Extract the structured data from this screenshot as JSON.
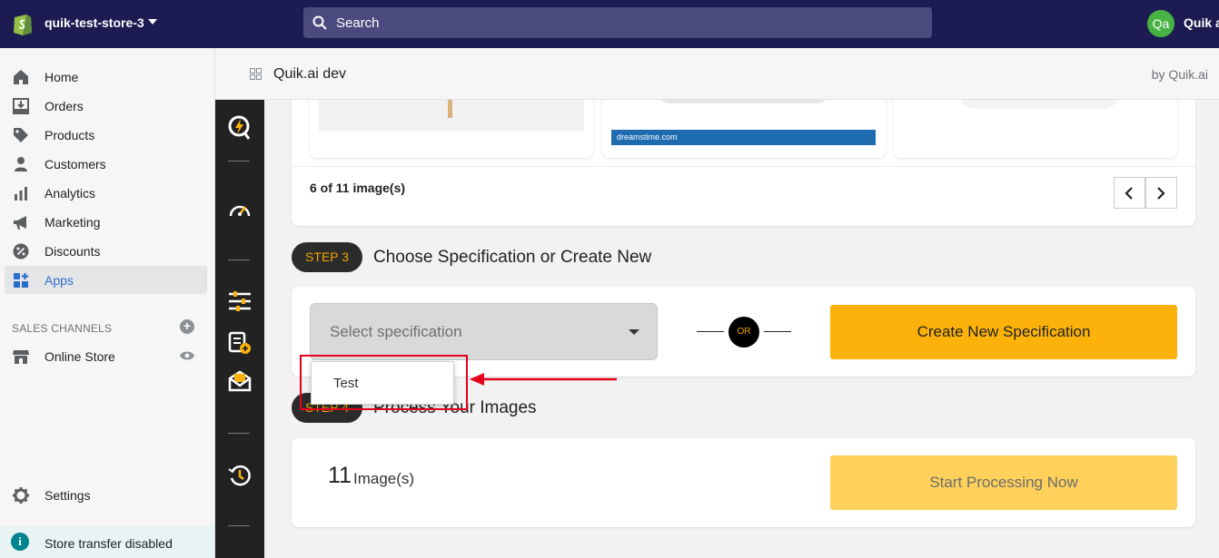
{
  "topbar": {
    "store_name": "quik-test-store-3",
    "search_placeholder": "Search",
    "avatar_initials": "Qa",
    "user_name": "Quik ai"
  },
  "sidebar": {
    "items": [
      {
        "label": "Home",
        "icon": "home-icon"
      },
      {
        "label": "Orders",
        "icon": "orders-icon"
      },
      {
        "label": "Products",
        "icon": "tag-icon"
      },
      {
        "label": "Customers",
        "icon": "person-icon"
      },
      {
        "label": "Analytics",
        "icon": "bar-chart-icon"
      },
      {
        "label": "Marketing",
        "icon": "megaphone-icon"
      },
      {
        "label": "Discounts",
        "icon": "discount-icon"
      },
      {
        "label": "Apps",
        "icon": "apps-icon",
        "active": true
      }
    ],
    "channels_header": "SALES CHANNELS",
    "online_store": "Online Store",
    "settings": "Settings",
    "transfer_notice": "Store transfer disabled"
  },
  "app_header": {
    "title": "Quik.ai dev",
    "by": "by Quik.ai"
  },
  "gallery": {
    "count_text": "6 of 11 image(s)",
    "watermark": "dreamstime.com"
  },
  "step3": {
    "pill": "STEP 3",
    "title": "Choose Specification or Create New",
    "select_placeholder": "Select specification",
    "or_label": "OR",
    "create_button": "Create New Specification"
  },
  "step4": {
    "pill": "STEP 4",
    "title": "Process Your Images",
    "count": "11",
    "count_label": "Image(s)",
    "start_button": "Start Processing Now"
  },
  "dropdown": {
    "options": [
      "Test"
    ]
  },
  "colors": {
    "topbar": "#1c1c52",
    "accent": "#fcb20a",
    "highlight": "#e5001c",
    "active_nav": "#2c6ecb"
  }
}
